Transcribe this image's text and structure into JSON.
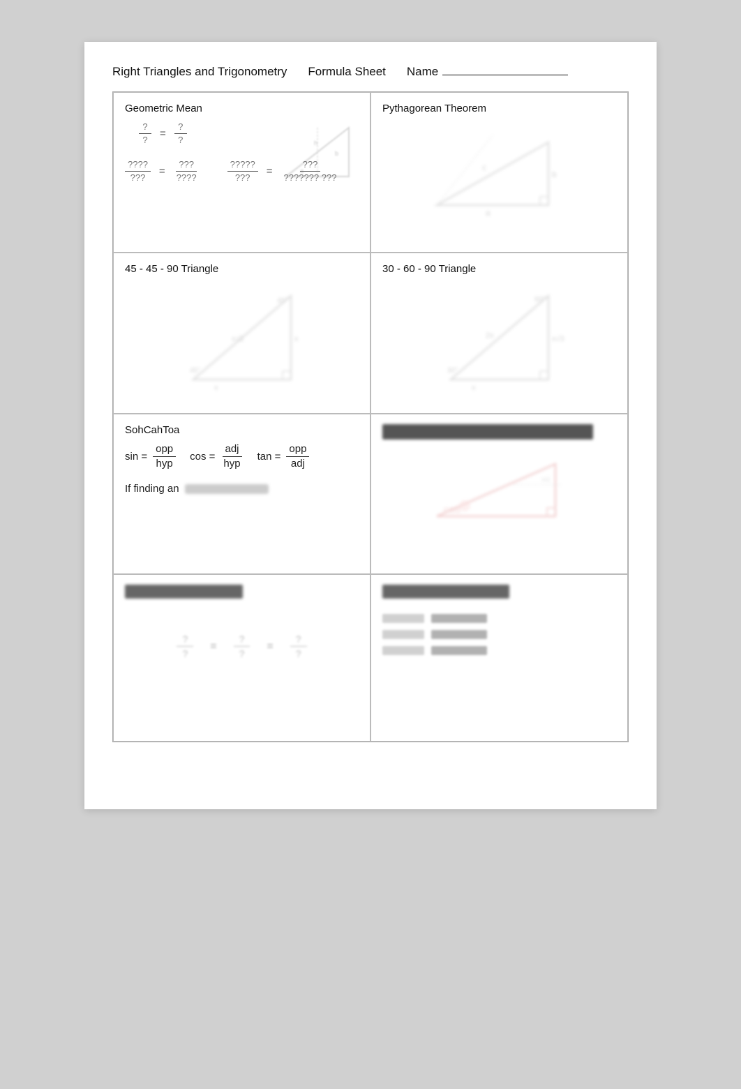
{
  "header": {
    "title": "Right Triangles and Trigonometry",
    "sheet": "Formula Sheet",
    "name_label": "Name",
    "name_line": ""
  },
  "sections": {
    "geometric_mean": {
      "title": "Geometric Mean",
      "frac1_num": "?",
      "frac1_den1": "?",
      "frac1_den2": "?",
      "frac1_num2": "?",
      "formula1_num": "????",
      "formula1_den": "???",
      "formula1_eq_num": "???",
      "formula1_eq_den": "????",
      "formula2_num": "?????",
      "formula2_den": "???",
      "formula2_eq_num": "???",
      "formula2_eq_den": "??????? ???"
    },
    "pythagorean": {
      "title": "Pythagorean Theorem"
    },
    "tri_45": {
      "title": "45 - 45 - 90 Triangle"
    },
    "tri_30": {
      "title": "30 - 60 - 90 Triangle"
    },
    "sohcahtoa": {
      "title": "SohCahToa",
      "sin_label": "sin =",
      "sin_num": "opp",
      "sin_den": "hyp",
      "cos_label": "cos =",
      "cos_num": "adj",
      "cos_den": "hyp",
      "tan_label": "tan =",
      "tan_num": "opp",
      "tan_den": "adj",
      "if_finding": "If finding an"
    },
    "trig_right": {
      "title": "Right Triangles and Trig Ratios"
    },
    "bottom_left": {
      "title": "Law of Sines",
      "frac1_num": "?",
      "frac1_den": "?",
      "frac2_num": "?",
      "frac2_den": "?",
      "frac3_num": "?",
      "frac3_den": "?"
    },
    "bottom_right": {
      "title": "Law of Cosines",
      "row1_label": "a² = b²+c²",
      "row1_value": "- 2bc cos A",
      "row2_label": "b² = a²+c²",
      "row2_value": "- 2ac cos B",
      "row3_label": "c² = a²+b²",
      "row3_value": "- 2ab cos C"
    }
  }
}
